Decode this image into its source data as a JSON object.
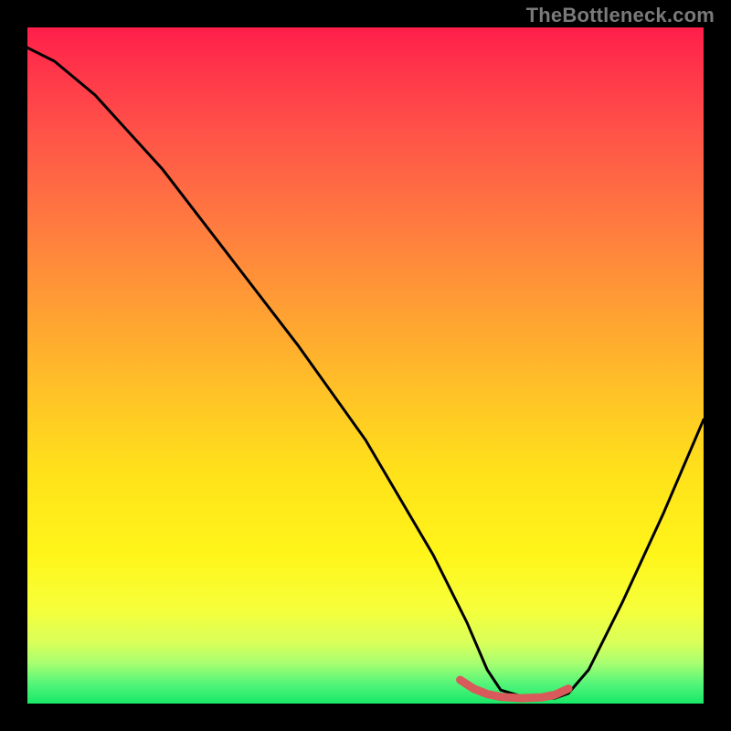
{
  "watermark": "TheBottleneck.com",
  "chart_data": {
    "type": "line",
    "title": "",
    "xlabel": "",
    "ylabel": "",
    "xlim": [
      0,
      100
    ],
    "ylim": [
      0,
      100
    ],
    "series": [
      {
        "name": "curve",
        "stroke": "#000000",
        "x": [
          0,
          4,
          10,
          20,
          30,
          40,
          50,
          60,
          65,
          68,
          70,
          74,
          78,
          80,
          83,
          88,
          94,
          100
        ],
        "values": [
          97,
          95,
          90,
          79,
          66,
          53,
          39,
          22,
          12,
          5,
          2,
          0.8,
          0.8,
          1.5,
          5,
          15,
          28,
          42
        ]
      },
      {
        "name": "highlight",
        "stroke": "#d85a5a",
        "x": [
          64,
          66,
          68,
          70,
          73,
          76,
          78,
          80
        ],
        "values": [
          3.5,
          2.2,
          1.4,
          1.0,
          0.8,
          0.9,
          1.3,
          2.2
        ]
      }
    ],
    "gradient_stops": [
      {
        "pos": 0,
        "color": "#ff1e4a"
      },
      {
        "pos": 50,
        "color": "#ffc227"
      },
      {
        "pos": 80,
        "color": "#fff51a"
      },
      {
        "pos": 100,
        "color": "#18e867"
      }
    ]
  }
}
